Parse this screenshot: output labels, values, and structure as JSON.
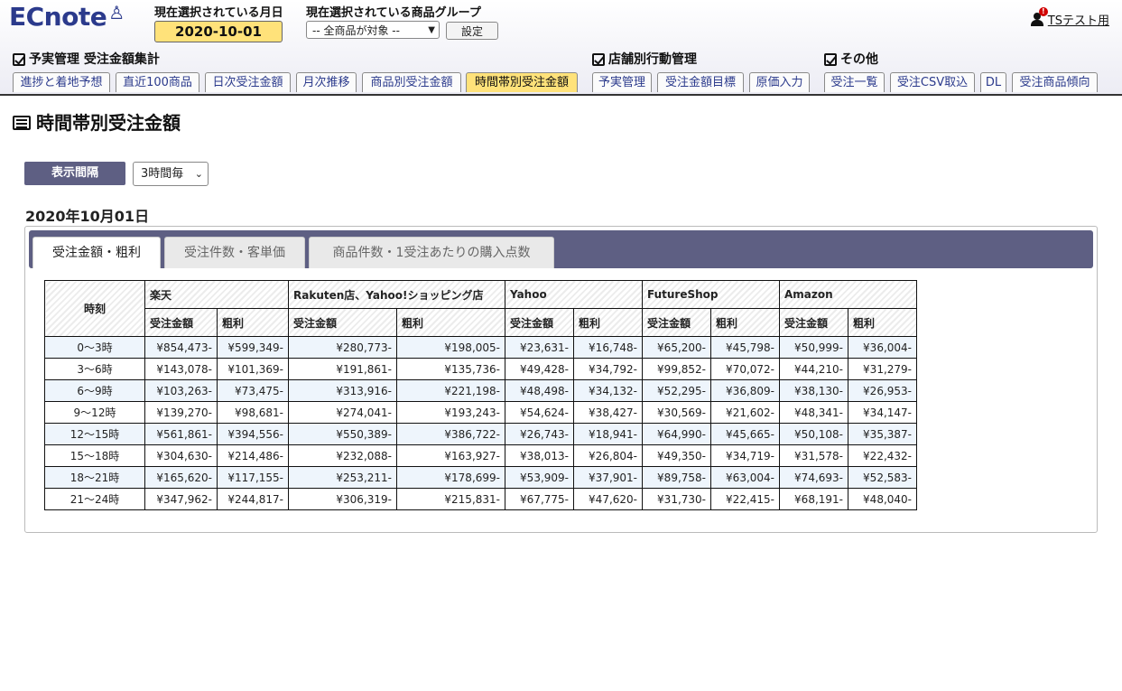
{
  "header": {
    "logo": "ECnote",
    "month_label": "現在選択されている月日",
    "month_value": "2020-10-01",
    "group_label": "現在選択されている商品グループ",
    "group_value": "-- 全商品が対象 --",
    "set_button": "設定",
    "user_name": "TSテスト用",
    "alert_mark": "!"
  },
  "sections": [
    {
      "title": "予実管理 受注金額集計"
    },
    {
      "title": "店舗別行動管理"
    },
    {
      "title": "その他"
    }
  ],
  "nav_tabs": [
    {
      "label": "進捗と着地予想"
    },
    {
      "label": "直近100商品"
    },
    {
      "label": "日次受注金額"
    },
    {
      "label": "月次推移"
    },
    {
      "label": "商品別受注金額"
    },
    {
      "label": "時間帯別受注金額",
      "active": true
    },
    {
      "label": "予実管理"
    },
    {
      "label": "受注金額目標"
    },
    {
      "label": "原価入力"
    },
    {
      "label": "受注一覧"
    },
    {
      "label": "受注CSV取込"
    },
    {
      "label": "DL"
    },
    {
      "label": "受注商品傾向"
    }
  ],
  "page": {
    "title": "時間帯別受注金額",
    "interval_label": "表示間隔",
    "interval_value": "3時間毎",
    "date_label": "2020年10月01日"
  },
  "panel_tabs": [
    {
      "label": "受注金額・粗利",
      "active": true
    },
    {
      "label": "受注件数・客単価"
    },
    {
      "label": "商品件数・1受注あたりの購入点数"
    }
  ],
  "table": {
    "time_header": "時刻",
    "stores": [
      "楽天",
      "Rakuten店、Yahoo!ショッピング店",
      "Yahoo",
      "FutureShop",
      "Amazon"
    ],
    "sub_headers": [
      "受注金額",
      "粗利"
    ],
    "rows": [
      {
        "time": "0～3時",
        "values": [
          "¥854,473-",
          "¥599,349-",
          "¥280,773-",
          "¥198,005-",
          "¥23,631-",
          "¥16,748-",
          "¥65,200-",
          "¥45,798-",
          "¥50,999-",
          "¥36,004-"
        ]
      },
      {
        "time": "3～6時",
        "values": [
          "¥143,078-",
          "¥101,369-",
          "¥191,861-",
          "¥135,736-",
          "¥49,428-",
          "¥34,792-",
          "¥99,852-",
          "¥70,072-",
          "¥44,210-",
          "¥31,279-"
        ]
      },
      {
        "time": "6～9時",
        "values": [
          "¥103,263-",
          "¥73,475-",
          "¥313,916-",
          "¥221,198-",
          "¥48,498-",
          "¥34,132-",
          "¥52,295-",
          "¥36,809-",
          "¥38,130-",
          "¥26,953-"
        ]
      },
      {
        "time": "9～12時",
        "values": [
          "¥139,270-",
          "¥98,681-",
          "¥274,041-",
          "¥193,243-",
          "¥54,624-",
          "¥38,427-",
          "¥30,569-",
          "¥21,602-",
          "¥48,341-",
          "¥34,147-"
        ]
      },
      {
        "time": "12～15時",
        "values": [
          "¥561,861-",
          "¥394,556-",
          "¥550,389-",
          "¥386,722-",
          "¥26,743-",
          "¥18,941-",
          "¥64,990-",
          "¥45,665-",
          "¥50,108-",
          "¥35,387-"
        ]
      },
      {
        "time": "15～18時",
        "values": [
          "¥304,630-",
          "¥214,486-",
          "¥232,088-",
          "¥163,927-",
          "¥38,013-",
          "¥26,804-",
          "¥49,350-",
          "¥34,719-",
          "¥31,578-",
          "¥22,432-"
        ]
      },
      {
        "time": "18～21時",
        "values": [
          "¥165,620-",
          "¥117,155-",
          "¥253,211-",
          "¥178,699-",
          "¥53,909-",
          "¥37,901-",
          "¥89,758-",
          "¥63,004-",
          "¥74,693-",
          "¥52,583-"
        ]
      },
      {
        "time": "21～24時",
        "values": [
          "¥347,962-",
          "¥244,817-",
          "¥306,319-",
          "¥215,831-",
          "¥67,775-",
          "¥47,620-",
          "¥31,730-",
          "¥22,415-",
          "¥68,191-",
          "¥48,040-"
        ]
      }
    ]
  }
}
